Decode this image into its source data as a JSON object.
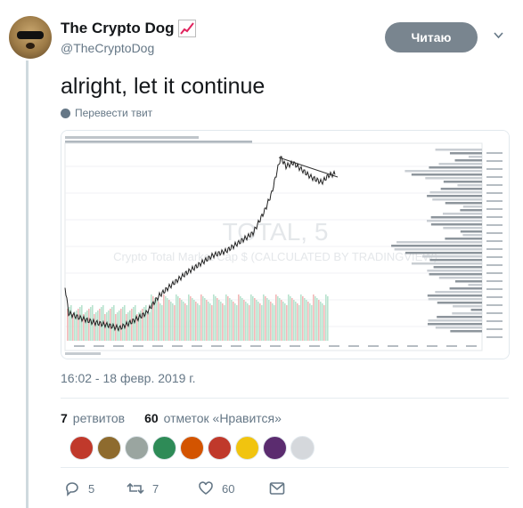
{
  "author": {
    "name": "The Crypto Dog",
    "handle": "@TheCryptoDog"
  },
  "follow_button": "Читаю",
  "tweet": {
    "text": "alright, let it continue",
    "translate_label": "Перевести твит",
    "timestamp": "16:02 - 18 февр. 2019 г."
  },
  "chart_image": {
    "watermark_title": "TOTAL, 5",
    "watermark_subtitle": "Crypto Total Market Cap $ (CALCULATED BY TRADINGVIEW)"
  },
  "stats": {
    "retweets_count": "7",
    "retweets_label": "ретвитов",
    "likes_count": "60",
    "likes_label": "отметок «Нравится»"
  },
  "actions": {
    "replies": "5",
    "retweets": "7",
    "likes": "60"
  },
  "liker_colors": [
    "#c0392b",
    "#8e6b2e",
    "#9aa5a0",
    "#2e8b57",
    "#d35400",
    "#c0392b",
    "#f1c40f",
    "#5b2c6f",
    "#d5d8dc"
  ],
  "colors": {
    "accent": "#1da1f2",
    "muted": "#657786",
    "follow_bg": "#79858f"
  }
}
